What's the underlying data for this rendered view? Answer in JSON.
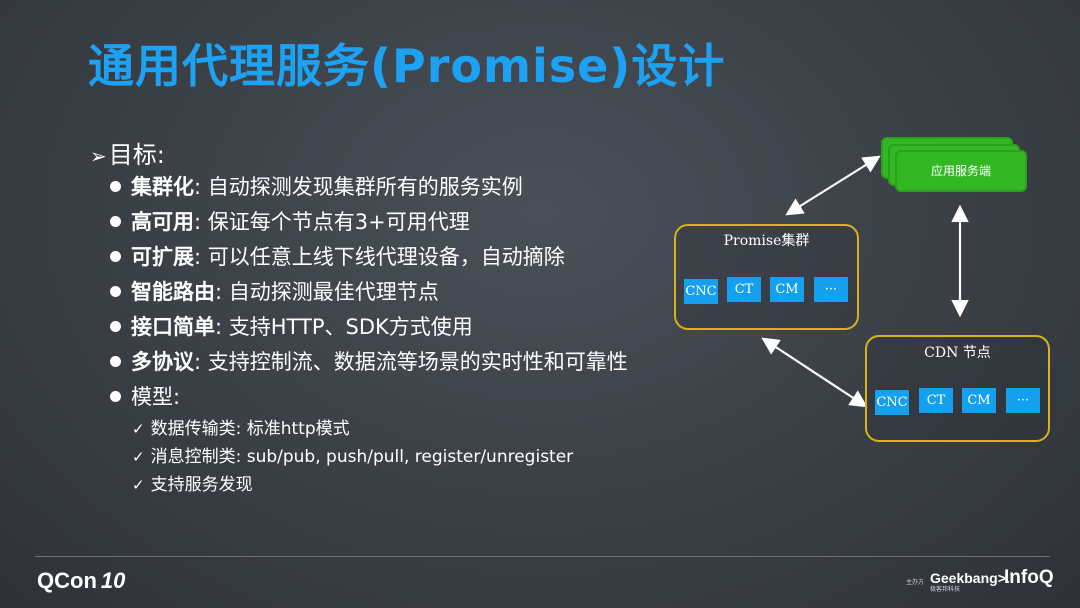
{
  "title": "通用代理服务(Promise)设计",
  "goal": {
    "arrow": "➢",
    "label": "目标:"
  },
  "bullets": [
    {
      "bold": "集群化",
      "text": ": 自动探测发现集群所有的服务实例"
    },
    {
      "bold": "高可用",
      "text": ": 保证每个节点有3+可用代理"
    },
    {
      "bold": "可扩展",
      "text": ": 可以任意上线下线代理设备，自动摘除"
    },
    {
      "bold": "智能路由",
      "text": ": 自动探测最佳代理节点"
    },
    {
      "bold": "接口简单",
      "text": ": 支持HTTP、SDK方式使用"
    },
    {
      "bold": "多协议",
      "text": ": 支持控制流、数据流等场景的实时性和可靠性"
    },
    {
      "bold": "",
      "text": "模型:"
    }
  ],
  "subitems": [
    {
      "check": "✓",
      "text": "数据传输类: 标准http模式"
    },
    {
      "check": "✓",
      "text": "消息控制类: sub/pub, push/pull, register/unregister"
    },
    {
      "check": "✓",
      "text": "支持服务发现"
    }
  ],
  "diagram": {
    "app_server": "应用服务端",
    "promise_cluster": {
      "label": "Promise集群",
      "chips": [
        "CNC",
        "CT",
        "CM",
        "···"
      ]
    },
    "cdn_node": {
      "label": "CDN 节点",
      "chips": [
        "CNC",
        "CT",
        "CM",
        "···"
      ]
    },
    "colors": {
      "box_border": "#d8b21a",
      "chip": "#14a0ee",
      "app_server": "#33b824",
      "title": "#1da1f2"
    }
  },
  "footer": {
    "qcon": "QCon",
    "qcon_edition": "10",
    "sponsor": "主办方",
    "geekbang": "Geekbang>.",
    "geekbang_sub": "极客邦科技",
    "infoq": "InfoQ"
  }
}
